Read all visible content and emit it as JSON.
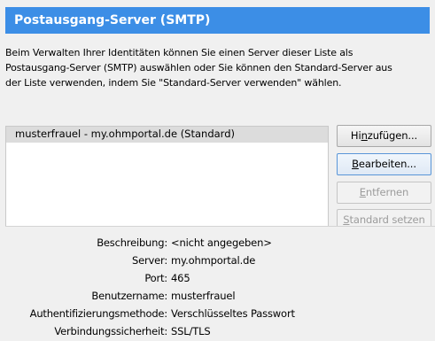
{
  "header": {
    "title": "Postausgang-Server (SMTP)"
  },
  "description": {
    "line1": "Beim Verwalten Ihrer Identitäten können Sie einen Server dieser Liste als",
    "line2": "Postausgang-Server (SMTP) auswählen oder Sie können den Standard-Server aus",
    "line3": "der Liste verwenden, indem Sie \"Standard-Server verwenden\" wählen."
  },
  "servers": [
    {
      "label": "musterfrauel - my.ohmportal.de (Standard)",
      "selected": true
    }
  ],
  "buttons": {
    "add": {
      "pre": "Hi",
      "accel": "n",
      "post": "zufügen..."
    },
    "edit": {
      "pre": "",
      "accel": "B",
      "post": "earbeiten..."
    },
    "remove": {
      "pre": "",
      "accel": "E",
      "post": "ntfernen"
    },
    "set_default": {
      "pre": "",
      "accel": "S",
      "post": "tandard setzen"
    }
  },
  "details": {
    "description": {
      "label": "Beschreibung:",
      "value": "<nicht angegeben>"
    },
    "server": {
      "label": "Server:",
      "value": "my.ohmportal.de"
    },
    "port": {
      "label": "Port:",
      "value": "465"
    },
    "username": {
      "label": "Benutzername:",
      "value": "musterfrauel"
    },
    "auth": {
      "label": "Authentifizierungsmethode:",
      "value": "Verschlüsseltes Passwort"
    },
    "security": {
      "label": "Verbindungssicherheit:",
      "value": "SSL/TLS"
    }
  },
  "colors": {
    "header_bg": "#3c8ee6",
    "selection_bg": "#dcdcdc"
  }
}
